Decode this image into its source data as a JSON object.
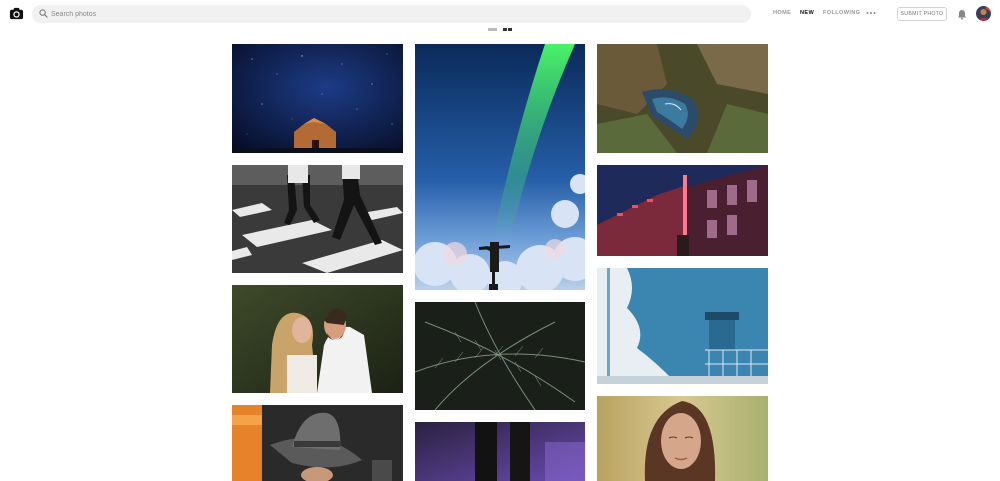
{
  "header": {
    "logo_icon": "camera-icon",
    "search": {
      "placeholder": "Search photos",
      "value": ""
    },
    "nav": [
      {
        "label": "HOME",
        "active": false
      },
      {
        "label": "NEW",
        "active": true
      },
      {
        "label": "FOLLOWING",
        "active": false
      }
    ],
    "more_icon": "more-dots-icon",
    "submit_label": "SUBMIT PHOTO",
    "notifications_icon": "bell-icon"
  },
  "view_toggle": {
    "options": [
      "list-view-icon",
      "grid-view-icon"
    ],
    "selected": "grid-view-icon"
  },
  "photos": {
    "columns": [
      [
        "night sky with stone hut",
        "zebra crossing with walking legs",
        "couple embracing",
        "person in grey fedora hat"
      ],
      [
        "aurora borealis with person above clouds",
        "fern leaves",
        "legs on purple lit floor"
      ],
      [
        "coastal cliffs aerial view",
        "red neon building at night",
        "blue wall with white stair railing",
        "woman in golden field"
      ]
    ]
  },
  "colors": {
    "accent_text": "#111111",
    "muted_text": "#999999",
    "search_bg": "#f1f1f1"
  }
}
